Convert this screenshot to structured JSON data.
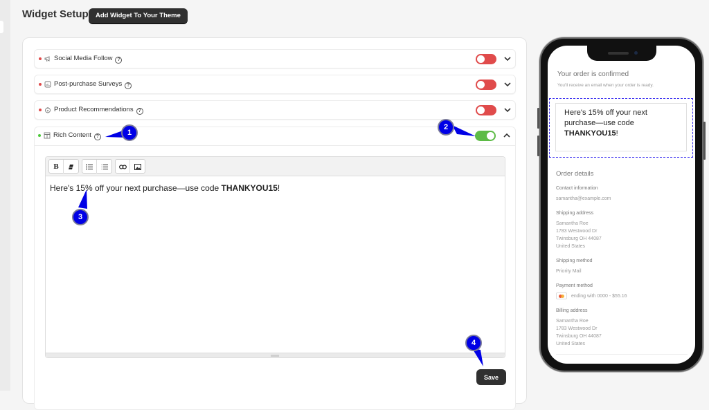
{
  "header": {
    "title": "Widget Setup",
    "add_widget_label": "Add Widget To Your Theme"
  },
  "widgets": [
    {
      "label": "Social Media Follow",
      "enabled": false,
      "expanded": false,
      "icon": "megaphone-icon",
      "status_color": "#e04b4b"
    },
    {
      "label": "Post-purchase Surveys",
      "enabled": false,
      "expanded": false,
      "icon": "survey-chart-icon",
      "status_color": "#e04b4b"
    },
    {
      "label": "Product Recommendations",
      "enabled": false,
      "expanded": false,
      "icon": "recommendation-icon",
      "status_color": "#e04b4b"
    },
    {
      "label": "Rich Content",
      "enabled": true,
      "expanded": true,
      "icon": "text-layout-icon",
      "status_color": "#4cc93a"
    }
  ],
  "help_glyph": "?",
  "editor": {
    "toolbar": {
      "bold": "B",
      "clear_format": "✎",
      "bullet_list": "☰",
      "numbered_list": "≡",
      "link": "∞",
      "image": "▣"
    },
    "content_prefix": "Here's 15% off your next purchase—use code ",
    "content_code": "THANKYOU15",
    "content_suffix": "!"
  },
  "save_label": "Save",
  "callouts": [
    "1",
    "2",
    "3",
    "4"
  ],
  "colors": {
    "toggle_off": "#e04b4b",
    "toggle_on": "#5dbb46",
    "callout": "#0000e6",
    "dark_button": "#303030",
    "preview_border": "#3a2ff0"
  },
  "preview": {
    "title": "Your order is confirmed",
    "subtitle": "You'll receive an email when your order is ready.",
    "widget_prefix": "Here's 15% off your next purchase—use code ",
    "widget_code": "THANKYOU15",
    "widget_suffix": "!",
    "order_details_heading": "Order details",
    "contact_label": "Contact information",
    "contact_email": "samantha@example.com",
    "shipping_address_label": "Shipping address",
    "shipping_address": [
      "Samantha Roe",
      "1783 Westwood Dr",
      "Twinsburg OH 44087",
      "United States"
    ],
    "shipping_method_label": "Shipping method",
    "shipping_method": "Priority Mail",
    "payment_method_label": "Payment method",
    "payment_method": "ending with 0000 - $55.16",
    "billing_address_label": "Billing address",
    "billing_address": [
      "Samantha Roe",
      "1783 Westwood Dr",
      "Twinsburg OH 44087",
      "United States"
    ]
  }
}
